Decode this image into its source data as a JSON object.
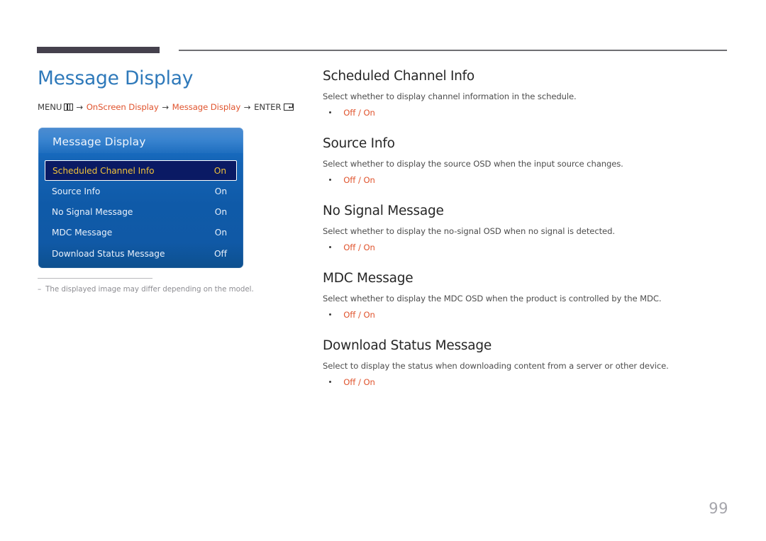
{
  "page": {
    "title": "Message Display",
    "number": "99"
  },
  "breadcrumb": {
    "menu_label": "MENU",
    "menu_icon": "menu-grid-icon",
    "arrow": "→",
    "path_1": "OnScreen Display",
    "path_2": "Message Display",
    "enter_label": "ENTER",
    "enter_icon": "enter-return-icon"
  },
  "osd": {
    "title": "Message Display",
    "rows": [
      {
        "label": "Scheduled Channel Info",
        "value": "On",
        "selected": true
      },
      {
        "label": "Source Info",
        "value": "On",
        "selected": false
      },
      {
        "label": "No Signal Message",
        "value": "On",
        "selected": false
      },
      {
        "label": "MDC Message",
        "value": "On",
        "selected": false
      },
      {
        "label": "Download Status Message",
        "value": "Off",
        "selected": false
      }
    ]
  },
  "footnote": {
    "dash": "–",
    "text": "The displayed image may differ depending on the model."
  },
  "sections": [
    {
      "title": "Scheduled Channel Info",
      "description": "Select whether to display channel information in the schedule.",
      "options": "Off / On"
    },
    {
      "title": "Source Info",
      "description": "Select whether to display the source OSD when the input source changes.",
      "options": "Off / On"
    },
    {
      "title": "No Signal Message",
      "description": "Select whether to display the no-signal OSD when no signal is detected.",
      "options": "Off / On"
    },
    {
      "title": "MDC Message",
      "description": "Select whether to display the MDC OSD when the product is controlled by the MDC.",
      "options": "Off / On"
    },
    {
      "title": "Download Status Message",
      "description": "Select to display the status when downloading content from a server or other device.",
      "options": "Off / On"
    }
  ],
  "colors": {
    "heading_blue": "#2e79ba",
    "accent_orange": "#e0542e",
    "osd_blue": "#1463b4",
    "osd_selected_bg": "#0a1a64",
    "osd_selected_text": "#f0c23a",
    "rule_dark": "#45414d"
  }
}
